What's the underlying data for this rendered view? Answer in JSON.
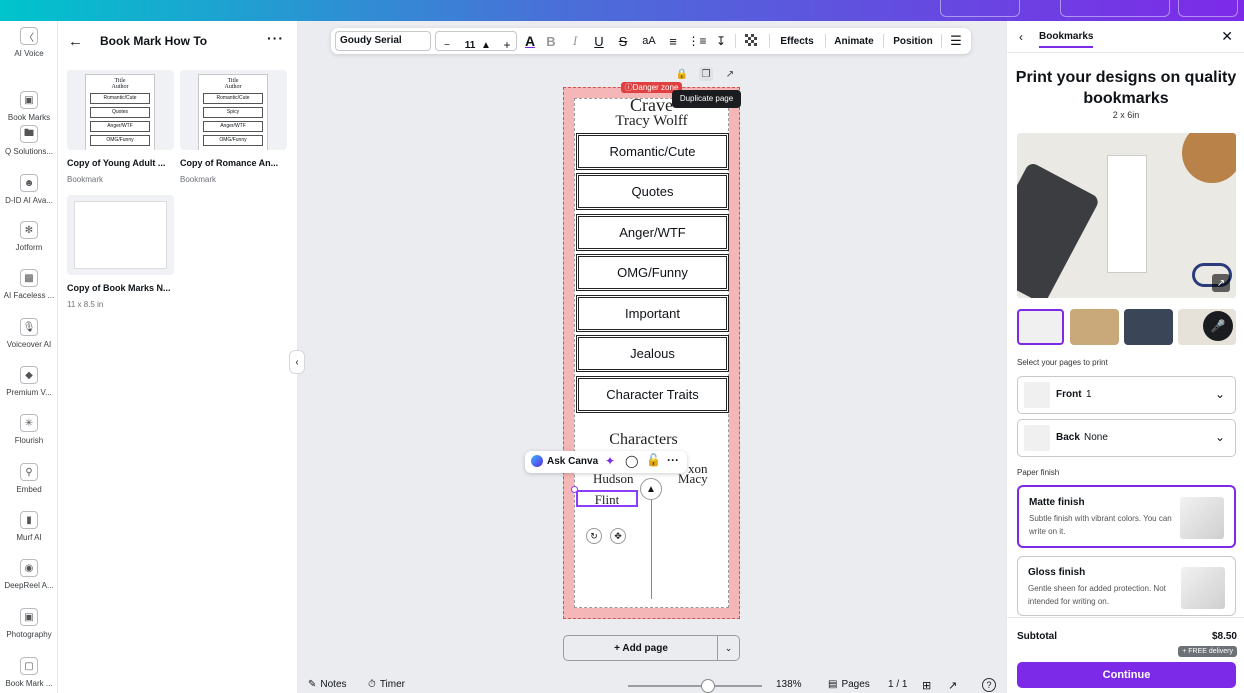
{
  "colors": {
    "accent": "#7d2ae8",
    "danger": "#e04040",
    "page_bg": "#f4b6b6"
  },
  "rail": [
    {
      "label": "AI Voice",
      "icon": "ai-voice-icon"
    },
    {
      "label": "Book Marks",
      "icon": "book-marks-icon"
    },
    {
      "label": "Q Solutions...",
      "icon": "folder-icon"
    },
    {
      "label": "D-ID AI Ava...",
      "icon": "avatar-icon"
    },
    {
      "label": "Jotform",
      "icon": "jotform-icon"
    },
    {
      "label": "AI Faceless ...",
      "icon": "faceless-icon"
    },
    {
      "label": "Voiceover AI",
      "icon": "voiceover-icon"
    },
    {
      "label": "Premium V...",
      "icon": "premium-icon"
    },
    {
      "label": "Flourish",
      "icon": "flourish-icon"
    },
    {
      "label": "Embed",
      "icon": "embed-icon"
    },
    {
      "label": "Murf AI",
      "icon": "murf-icon"
    },
    {
      "label": "DeepReel A...",
      "icon": "deepreel-icon"
    },
    {
      "label": "Photography",
      "icon": "photography-icon"
    },
    {
      "label": "Book Mark ...",
      "icon": "book-mark-icon"
    }
  ],
  "left_panel": {
    "title": "Book Mark How To",
    "items": [
      {
        "caption": "Copy of Young Adult ...",
        "sub": "Bookmark",
        "mini_title": "Title",
        "mini_author": "Author",
        "mini_rows": [
          "Romantic/Cute",
          "Quotes",
          "Anger/WTF",
          "OMG/Funny"
        ]
      },
      {
        "caption": "Copy of Romance An...",
        "sub": "Bookmark",
        "mini_title": "Title",
        "mini_author": "Author",
        "mini_rows": [
          "Romantic/Cute",
          "Spicy",
          "Anger/WTF",
          "OMG/Funny"
        ]
      },
      {
        "caption": "Copy of Book Marks N...",
        "sub": "11 x 8.5 in"
      }
    ]
  },
  "toolbar": {
    "font": "Goudy Serial",
    "size": "11",
    "minus": "−",
    "plus": "+",
    "aA": "aA",
    "effects": "Effects",
    "animate": "Animate",
    "position": "Position"
  },
  "canvas": {
    "danger_zone": "Danger zone",
    "tooltip": "Duplicate page",
    "title": "Crave",
    "author": "Tracy Wolff",
    "boxes": [
      "Romantic/Cute",
      "Quotes",
      "Anger/WTF",
      "OMG/Funny",
      "Important",
      "Jealous",
      "Character Traits"
    ],
    "characters_title": "Characters",
    "char_left": [
      "Hudson",
      "Flint"
    ],
    "char_right": [
      "xon",
      "Macy"
    ],
    "ask_canva": "Ask Canva",
    "add_page": "+ Add page"
  },
  "bottom": {
    "notes": "Notes",
    "timer": "Timer",
    "zoom": "138%",
    "zoom_fraction": 0.6,
    "pages": "Pages",
    "page_count": "1 / 1"
  },
  "right_panel": {
    "tab": "Bookmarks",
    "hero_title": "Print your designs on quality bookmarks",
    "hero_sub": "2 x 6in",
    "select_pages_label": "Select your pages to print",
    "front_label": "Front",
    "front_value": "1",
    "back_label": "Back",
    "back_value": "None",
    "paper_finish_label": "Paper finish",
    "finishes": [
      {
        "title": "Matte finish",
        "desc": "Subtle finish with vibrant colors. You can write on it.",
        "selected": true
      },
      {
        "title": "Gloss finish",
        "desc": "Gentle sheen for added protection. Not intended for writing on.",
        "selected": false
      }
    ],
    "subtotal_label": "Subtotal",
    "subtotal_value": "$8.50",
    "free_delivery": "+ FREE delivery",
    "continue": "Continue"
  }
}
